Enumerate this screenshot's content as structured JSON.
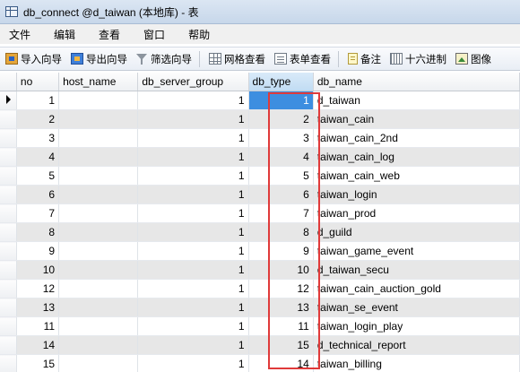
{
  "window": {
    "title": "db_connect @d_taiwan (本地库) - 表"
  },
  "menu": [
    "文件",
    "编辑",
    "查看",
    "窗口",
    "帮助"
  ],
  "toolbar": {
    "import_label": "导入向导",
    "export_label": "导出向导",
    "filter_label": "筛选向导",
    "grid_view_label": "网格查看",
    "form_view_label": "表单查看",
    "memo_label": "备注",
    "hex_label": "十六进制",
    "image_label": "图像"
  },
  "table": {
    "columns": [
      "no",
      "host_name",
      "db_server_group",
      "db_type",
      "db_name"
    ],
    "sorted_column": "db_type",
    "selected_row": 0,
    "rows": [
      {
        "no": "1",
        "host_name": "",
        "db_server_group": "1",
        "db_type": "1",
        "db_name": "d_taiwan"
      },
      {
        "no": "2",
        "host_name": "",
        "db_server_group": "1",
        "db_type": "2",
        "db_name": "taiwan_cain"
      },
      {
        "no": "3",
        "host_name": "",
        "db_server_group": "1",
        "db_type": "3",
        "db_name": "taiwan_cain_2nd"
      },
      {
        "no": "4",
        "host_name": "",
        "db_server_group": "1",
        "db_type": "4",
        "db_name": "taiwan_cain_log"
      },
      {
        "no": "5",
        "host_name": "",
        "db_server_group": "1",
        "db_type": "5",
        "db_name": "taiwan_cain_web"
      },
      {
        "no": "6",
        "host_name": "",
        "db_server_group": "1",
        "db_type": "6",
        "db_name": "taiwan_login"
      },
      {
        "no": "7",
        "host_name": "",
        "db_server_group": "1",
        "db_type": "7",
        "db_name": "taiwan_prod"
      },
      {
        "no": "8",
        "host_name": "",
        "db_server_group": "1",
        "db_type": "8",
        "db_name": "d_guild"
      },
      {
        "no": "9",
        "host_name": "",
        "db_server_group": "1",
        "db_type": "9",
        "db_name": "taiwan_game_event"
      },
      {
        "no": "10",
        "host_name": "",
        "db_server_group": "1",
        "db_type": "10",
        "db_name": "d_taiwan_secu"
      },
      {
        "no": "12",
        "host_name": "",
        "db_server_group": "1",
        "db_type": "12",
        "db_name": "taiwan_cain_auction_gold"
      },
      {
        "no": "13",
        "host_name": "",
        "db_server_group": "1",
        "db_type": "13",
        "db_name": "taiwan_se_event"
      },
      {
        "no": "11",
        "host_name": "",
        "db_server_group": "1",
        "db_type": "11",
        "db_name": "taiwan_login_play"
      },
      {
        "no": "14",
        "host_name": "",
        "db_server_group": "1",
        "db_type": "15",
        "db_name": "d_technical_report"
      },
      {
        "no": "15",
        "host_name": "",
        "db_server_group": "1",
        "db_type": "14",
        "db_name": "taiwan_billing"
      }
    ]
  },
  "colors": {
    "highlight": "#e03a3a",
    "selection": "#3d8ee0",
    "row_alt": "#e7e7e7"
  }
}
